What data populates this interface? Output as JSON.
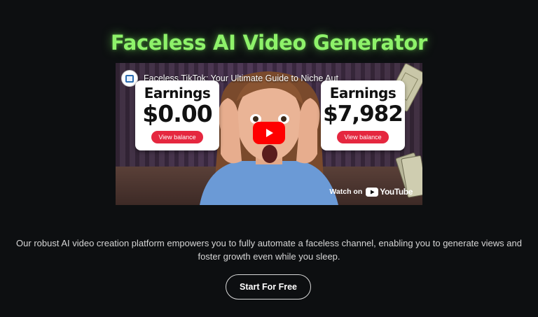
{
  "hero": {
    "title": "Faceless AI Video Generator",
    "title_color": "#8ef26a"
  },
  "video": {
    "title": "Faceless TikTok: Your Ultimate Guide to Niche Aut",
    "left_card": {
      "label": "Earnings",
      "amount": "$0.00",
      "button": "View balance"
    },
    "right_card": {
      "label": "Earnings",
      "amount": "$7,982",
      "button": "View balance"
    },
    "watch_on": "Watch on",
    "youtube": "YouTube",
    "channel_icon": "channel-avatar-icon",
    "play_icon": "youtube-play-icon"
  },
  "description": "Our robust AI video creation platform empowers you to fully automate a faceless channel, enabling you to generate views and foster growth even while you sleep.",
  "cta": {
    "label": "Start For Free"
  },
  "colors": {
    "background": "#0d0f11",
    "accent": "#8ef26a",
    "youtube_red": "#ff0000",
    "badge_red": "#e5273f"
  }
}
